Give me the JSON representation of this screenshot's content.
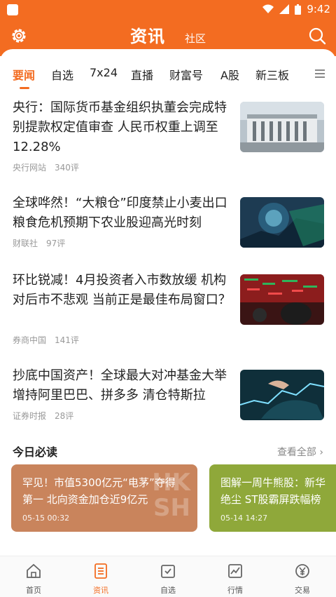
{
  "status_bar": {
    "time": "9:42"
  },
  "header": {
    "title": "资讯",
    "subtitle": "社区"
  },
  "tabs": [
    "要闻",
    "自选",
    "7x24",
    "直播",
    "财富号",
    "A股",
    "新三板"
  ],
  "news": [
    {
      "title": "央行：国际货币基金组织执董会完成特别提款权定值审查 人民币权重上调至12.28%",
      "source": "央行网站",
      "comments": "340评"
    },
    {
      "title": "全球哗然！“大粮仓”印度禁止小麦出口 粮食危机预期下农业股迎高光时刻",
      "source": "财联社",
      "comments": "97评"
    },
    {
      "title": "环比锐减！4月投资者入市数放缓 机构对后市不悲观 当前正是最佳布局窗口？",
      "source": "券商中国",
      "comments": "141评"
    },
    {
      "title": "抄底中国资产！全球最大对冲基金大举增持阿里巴巴、拼多多 清仓特斯拉",
      "source": "证券时报",
      "comments": "28评"
    }
  ],
  "must_read": {
    "title": "今日必读",
    "see_all": "查看全部",
    "cards": [
      {
        "title_line1": "罕见！市值5300亿元“电茅”夺得",
        "title_line2": "第一 北向资金加仓近9亿元",
        "date": "05-15 00:32",
        "watermark": "HK\nSH",
        "color": "#c9845c"
      },
      {
        "title_line1": "图解一周牛熊股：新华",
        "title_line2": "绝尘 ST股霸屏跌幅榜",
        "date": "05-14 14:27",
        "color": "#8fa83a"
      }
    ]
  },
  "bottom_nav": [
    {
      "label": "首页",
      "icon": "home-icon"
    },
    {
      "label": "资讯",
      "icon": "news-icon"
    },
    {
      "label": "自选",
      "icon": "watchlist-icon"
    },
    {
      "label": "行情",
      "icon": "market-icon"
    },
    {
      "label": "交易",
      "icon": "trade-icon"
    }
  ],
  "colors": {
    "accent": "#f36c21"
  }
}
